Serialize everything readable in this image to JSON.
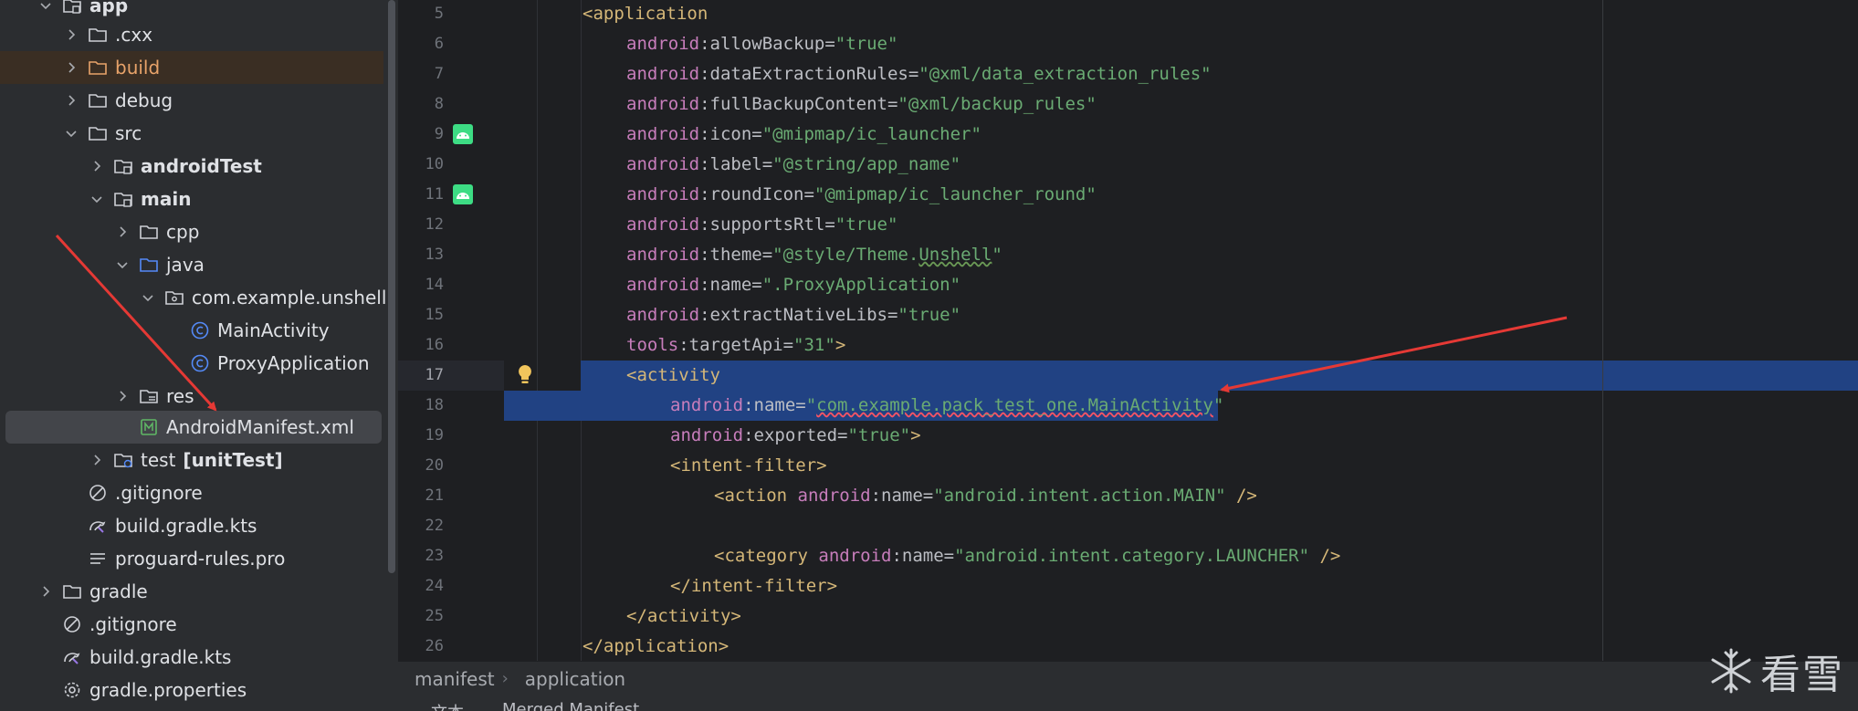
{
  "tree": {
    "items": [
      {
        "label": "app",
        "bold": true,
        "icon": "module-folder-icon",
        "chev": "down"
      },
      {
        "label": ".cxx",
        "icon": "folder-icon",
        "chev": "right"
      },
      {
        "label": "build",
        "icon": "folder-excluded-icon",
        "chev": "right",
        "excluded": true
      },
      {
        "label": "debug",
        "icon": "folder-icon",
        "chev": "right"
      },
      {
        "label": "src",
        "icon": "folder-icon",
        "chev": "down"
      },
      {
        "label": "androidTest",
        "bold": true,
        "icon": "module-folder-icon",
        "chev": "right"
      },
      {
        "label": "main",
        "bold": true,
        "icon": "module-folder-icon",
        "chev": "down"
      },
      {
        "label": "cpp",
        "icon": "folder-icon",
        "chev": "right"
      },
      {
        "label": "java",
        "icon": "source-folder-icon",
        "chev": "down"
      },
      {
        "label": "com.example.unshell",
        "icon": "package-icon",
        "chev": "down"
      },
      {
        "label": "MainActivity",
        "icon": "class-icon"
      },
      {
        "label": "ProxyApplication",
        "icon": "class-icon"
      },
      {
        "label": "res",
        "icon": "resource-folder-icon",
        "chev": "right"
      },
      {
        "label": "AndroidManifest.xml",
        "icon": "manifest-file-icon",
        "selected": true
      },
      {
        "label": "test",
        "suffix": "[unitTest]",
        "icon": "test-folder-icon",
        "chev": "right"
      },
      {
        "label": ".gitignore",
        "icon": "ignore-file-icon"
      },
      {
        "label": "build.gradle.kts",
        "icon": "gradle-file-icon"
      },
      {
        "label": "proguard-rules.pro",
        "icon": "text-file-icon"
      },
      {
        "label": "gradle",
        "icon": "folder-icon",
        "chev": "right"
      },
      {
        "label": ".gitignore",
        "icon": "ignore-file-icon"
      },
      {
        "label": "build.gradle.kts",
        "icon": "gradle-file-icon"
      },
      {
        "label": "gradle.properties",
        "icon": "settings-file-icon"
      }
    ]
  },
  "editor": {
    "lines": [
      {
        "n": "5",
        "tokens": [
          [
            "tag",
            "<application"
          ]
        ]
      },
      {
        "n": "6",
        "tokens": [
          [
            "ns",
            "android"
          ],
          [
            "attr",
            ":allowBackup="
          ],
          [
            "val",
            "\"true\""
          ]
        ]
      },
      {
        "n": "7",
        "tokens": [
          [
            "ns",
            "android"
          ],
          [
            "attr",
            ":dataExtractionRules="
          ],
          [
            "val",
            "\"@xml/data_extraction_rules\""
          ]
        ]
      },
      {
        "n": "8",
        "tokens": [
          [
            "ns",
            "android"
          ],
          [
            "attr",
            ":fullBackupContent="
          ],
          [
            "val",
            "\"@xml/backup_rules\""
          ]
        ]
      },
      {
        "n": "9",
        "tokens": [
          [
            "ns",
            "android"
          ],
          [
            "attr",
            ":icon="
          ],
          [
            "val",
            "\"@mipmap/ic_launcher\""
          ]
        ]
      },
      {
        "n": "10",
        "tokens": [
          [
            "ns",
            "android"
          ],
          [
            "attr",
            ":label="
          ],
          [
            "val",
            "\"@string/app_name\""
          ]
        ]
      },
      {
        "n": "11",
        "tokens": [
          [
            "ns",
            "android"
          ],
          [
            "attr",
            ":roundIcon="
          ],
          [
            "val",
            "\"@mipmap/ic_launcher_round\""
          ]
        ]
      },
      {
        "n": "12",
        "tokens": [
          [
            "ns",
            "android"
          ],
          [
            "attr",
            ":supportsRtl="
          ],
          [
            "val",
            "\"true\""
          ]
        ]
      },
      {
        "n": "13",
        "tokens": [
          [
            "ns",
            "android"
          ],
          [
            "attr",
            ":theme="
          ],
          [
            "val",
            "\"@style/Theme."
          ],
          [
            "valwarn",
            "Unshell"
          ],
          [
            "val",
            "\""
          ]
        ]
      },
      {
        "n": "14",
        "tokens": [
          [
            "ns",
            "android"
          ],
          [
            "attr",
            ":name="
          ],
          [
            "val",
            "\".ProxyApplication\""
          ]
        ]
      },
      {
        "n": "15",
        "tokens": [
          [
            "ns",
            "android"
          ],
          [
            "attr",
            ":extractNativeLibs="
          ],
          [
            "val",
            "\"true\""
          ]
        ]
      },
      {
        "n": "16",
        "tokens": [
          [
            "ns",
            "tools"
          ],
          [
            "attr",
            ":targetApi="
          ],
          [
            "val",
            "\"31\""
          ],
          [
            "tag",
            ">"
          ]
        ]
      },
      {
        "n": "17",
        "tokens": [
          [
            "tag",
            "<activity"
          ]
        ]
      },
      {
        "n": "18",
        "tokens": [
          [
            "ns",
            "android"
          ],
          [
            "attr",
            ":name="
          ],
          [
            "val",
            "\""
          ],
          [
            "valerr",
            "com.example.pack_test_one.MainActivity"
          ],
          [
            "val",
            "\""
          ]
        ]
      },
      {
        "n": "19",
        "tokens": [
          [
            "ns",
            "android"
          ],
          [
            "attr",
            ":exported="
          ],
          [
            "val",
            "\"true\""
          ],
          [
            "tag",
            ">"
          ]
        ]
      },
      {
        "n": "20",
        "tokens": [
          [
            "tag",
            "<intent-filter>"
          ]
        ]
      },
      {
        "n": "21",
        "tokens": [
          [
            "tag",
            "<action "
          ],
          [
            "ns",
            "android"
          ],
          [
            "attr",
            ":name="
          ],
          [
            "val",
            "\"android.intent.action.MAIN\""
          ],
          [
            "tag",
            " />"
          ]
        ]
      },
      {
        "n": "22",
        "tokens": []
      },
      {
        "n": "23",
        "tokens": [
          [
            "tag",
            "<category "
          ],
          [
            "ns",
            "android"
          ],
          [
            "attr",
            ":name="
          ],
          [
            "val",
            "\"android.intent.category.LAUNCHER\""
          ],
          [
            "tag",
            " />"
          ]
        ]
      },
      {
        "n": "24",
        "tokens": [
          [
            "tag",
            "</intent-filter>"
          ]
        ]
      },
      {
        "n": "25",
        "tokens": [
          [
            "tag",
            "</activity>"
          ]
        ]
      },
      {
        "n": "26",
        "tokens": [
          [
            "tag",
            "</application>"
          ]
        ]
      }
    ]
  },
  "breadcrumb": {
    "items": [
      "manifest",
      "application"
    ]
  },
  "bottom_tabs": {
    "text": "文本",
    "merged": "Merged Manifest"
  },
  "watermark": {
    "text": "看雪"
  },
  "colors": {
    "selection": "#214283",
    "arrow": "#e53935"
  }
}
